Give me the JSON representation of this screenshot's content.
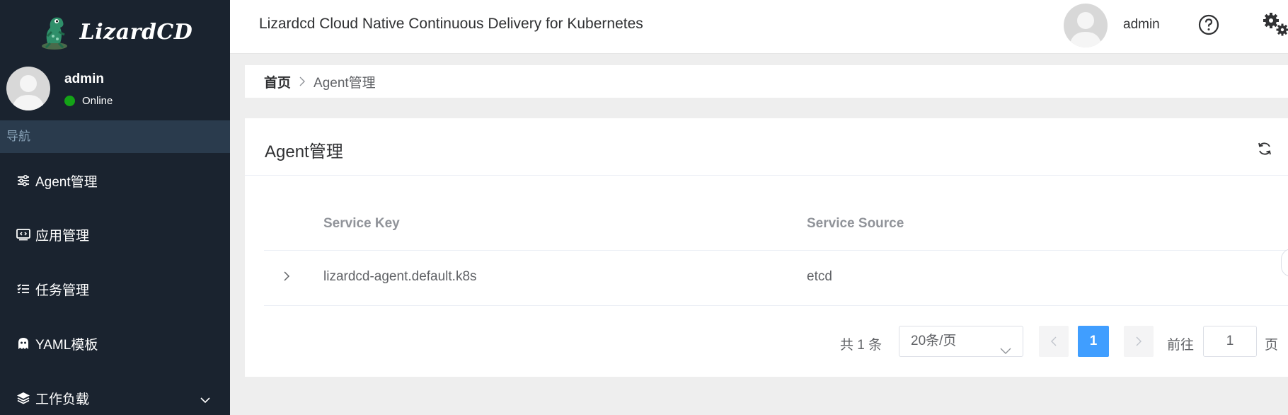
{
  "sidebar": {
    "logo_text": "LizardCD",
    "user": {
      "name": "admin",
      "status": "Online",
      "status_color": "#14a317"
    },
    "nav_header": "导航",
    "items": [
      {
        "label": "Agent管理",
        "icon": "sliders-icon"
      },
      {
        "label": "应用管理",
        "icon": "code-monitor-icon"
      },
      {
        "label": "任务管理",
        "icon": "task-list-icon"
      },
      {
        "label": "YAML模板",
        "icon": "ghost-icon"
      },
      {
        "label": "工作负载",
        "icon": "layers-icon",
        "expandable": true
      }
    ]
  },
  "header": {
    "title": "Lizardcd Cloud Native Continuous Delivery for Kubernetes",
    "user": "admin",
    "icons": [
      "help-icon",
      "gear-icon"
    ]
  },
  "breadcrumb": {
    "home": "首页",
    "current": "Agent管理"
  },
  "card": {
    "title": "Agent管理",
    "table": {
      "columns": [
        "Service Key",
        "Service Source"
      ],
      "rows": [
        {
          "service_key": "lizardcd-agent.default.k8s",
          "service_source": "etcd"
        }
      ]
    },
    "pagination": {
      "total": "共 1 条",
      "page_size": "20条/页",
      "current_page": "1",
      "goto_label": "前往",
      "goto_value": "1",
      "page_unit": "页"
    }
  },
  "colors": {
    "sidebar_bg": "#1a232f",
    "accent": "#409eff"
  }
}
